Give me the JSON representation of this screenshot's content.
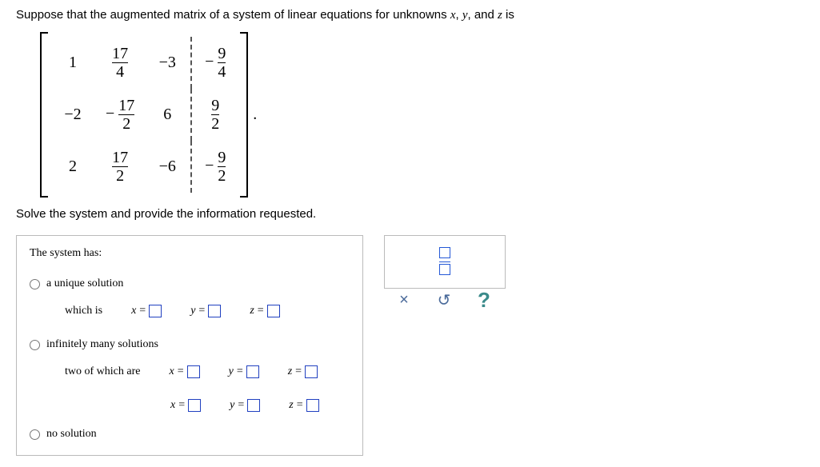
{
  "problem": {
    "intro_a": "Suppose that the augmented matrix of a system of linear equations for unknowns ",
    "var_x": "x",
    "comma1": ", ",
    "var_y": "y",
    "comma2": ", and ",
    "var_z": "z",
    "intro_b": " is"
  },
  "matrix": {
    "rows": [
      {
        "c1": "1",
        "c2_num": "17",
        "c2_den": "4",
        "c2_neg": false,
        "c3": "−3",
        "rhs_num": "9",
        "rhs_den": "4",
        "rhs_neg": true
      },
      {
        "c1": "−2",
        "c2_num": "17",
        "c2_den": "2",
        "c2_neg": true,
        "c3": "6",
        "rhs_num": "9",
        "rhs_den": "2",
        "rhs_neg": false
      },
      {
        "c1": "2",
        "c2_num": "17",
        "c2_den": "2",
        "c2_neg": false,
        "c3": "−6",
        "rhs_num": "9",
        "rhs_den": "2",
        "rhs_neg": true
      }
    ],
    "period": "."
  },
  "instruction": "Solve the system and provide the information requested.",
  "panel": {
    "heading": "The system has:",
    "opt_unique": "a unique solution",
    "which_is": "which is",
    "opt_inf": "infinitely many solutions",
    "two_of": "two of which are",
    "opt_none": "no solution",
    "eq_x": "x",
    "eq_y": "y",
    "eq_z": "z",
    "eq_sym": "="
  },
  "toolbox": {
    "fraction_tool": "fraction"
  },
  "actions": {
    "clear": "×",
    "reset": "↺",
    "help": "?"
  }
}
